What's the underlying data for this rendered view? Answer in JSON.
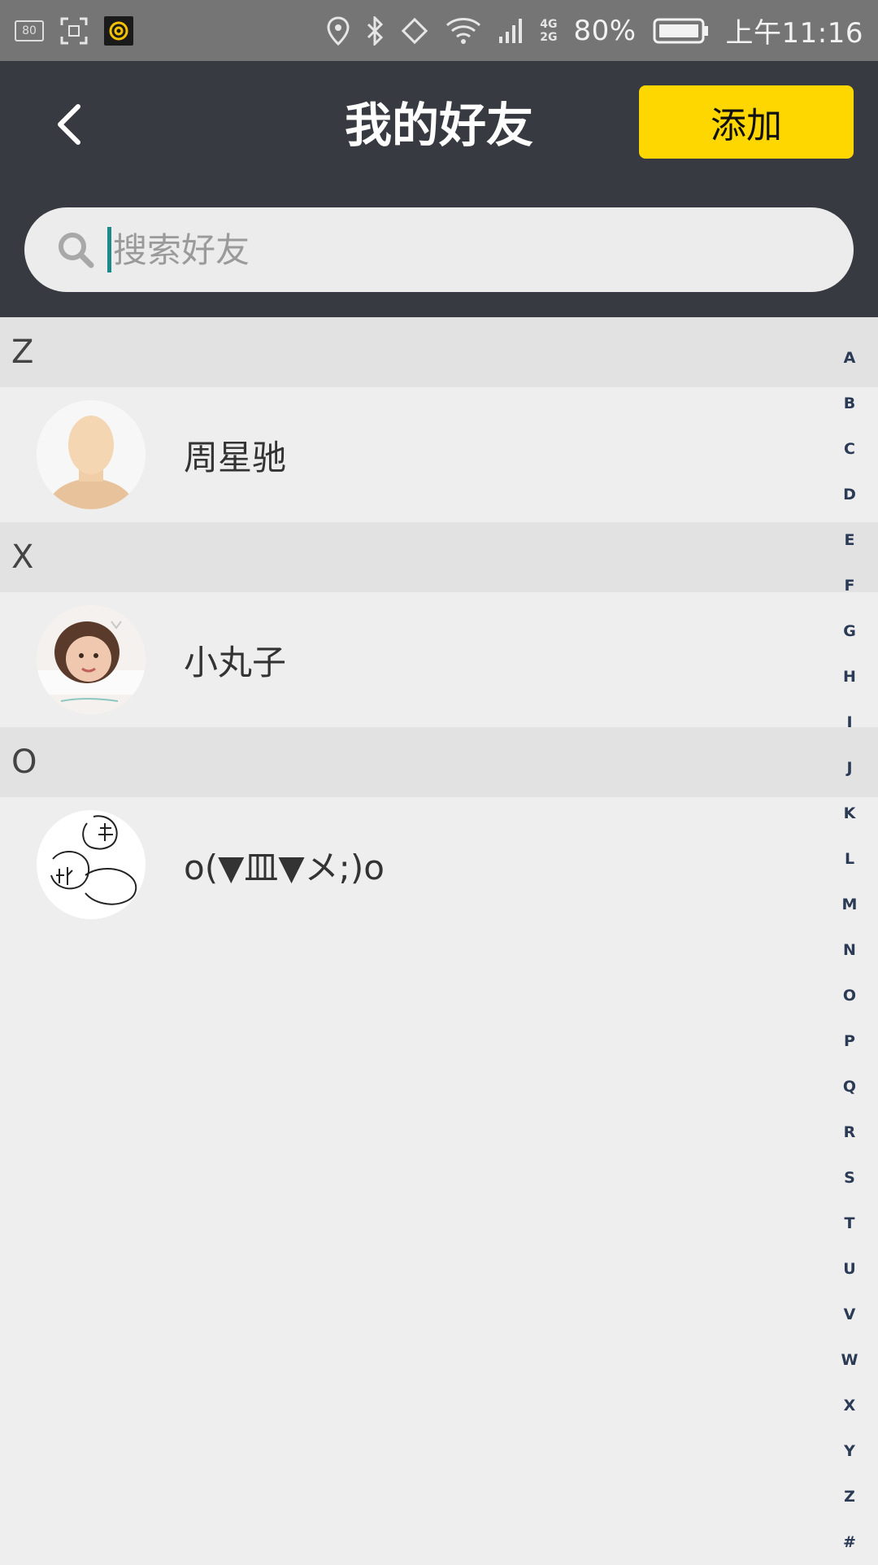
{
  "status_bar": {
    "badge": "80",
    "network_top": "4G",
    "network_bottom": "2G",
    "battery_percent": "80%",
    "time": "上午11:16"
  },
  "header": {
    "back_icon": "chevron-left-icon",
    "title": "我的好友",
    "add_label": "添加"
  },
  "search": {
    "placeholder": "搜索好友",
    "value": "",
    "icon": "search-icon"
  },
  "sections": [
    {
      "letter": "Z",
      "friends": [
        {
          "name": "周星驰",
          "avatar": "default-avatar"
        }
      ]
    },
    {
      "letter": "X",
      "friends": [
        {
          "name": "小丸子",
          "avatar": "photo-avatar-girl"
        }
      ]
    },
    {
      "letter": "O",
      "friends": [
        {
          "name": "o(▼皿▼メ;)o",
          "avatar": "sketch-avatar"
        }
      ]
    }
  ],
  "index_letters": [
    "A",
    "B",
    "C",
    "D",
    "E",
    "F",
    "G",
    "H",
    "I",
    "J",
    "K",
    "L",
    "M",
    "N",
    "O",
    "P",
    "Q",
    "R",
    "S",
    "T",
    "U",
    "V",
    "W",
    "X",
    "Y",
    "Z",
    "#"
  ],
  "colors": {
    "header_bg": "#383a42",
    "accent_button": "#ffd700",
    "status_bar_bg": "#757575",
    "section_header_bg": "#e2e2e2",
    "index_letter": "#2b3a55",
    "cursor": "#1a8a8a"
  }
}
